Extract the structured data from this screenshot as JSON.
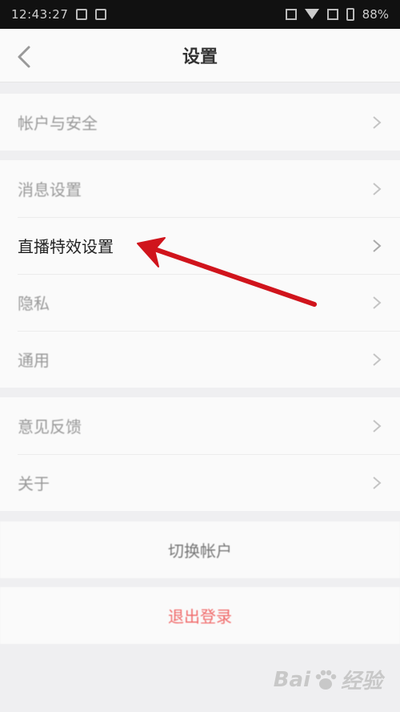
{
  "status_bar": {
    "time": "12:43:27",
    "battery": "88%"
  },
  "nav": {
    "title": "设置"
  },
  "groups": [
    {
      "items": [
        {
          "label": "帐户与安全"
        }
      ]
    },
    {
      "items": [
        {
          "label": "消息设置"
        },
        {
          "label": "直播特效设置"
        },
        {
          "label": "隐私"
        },
        {
          "label": "通用"
        }
      ]
    },
    {
      "items": [
        {
          "label": "意见反馈"
        },
        {
          "label": "关于"
        }
      ]
    }
  ],
  "actions": {
    "switch_account": "切换帐户",
    "logout": "退出登录"
  },
  "colors": {
    "logout_text": "#f06a6a",
    "annotation_arrow": "#d0141c"
  },
  "watermark": {
    "text_left": "Bai",
    "text_right": "经验"
  }
}
